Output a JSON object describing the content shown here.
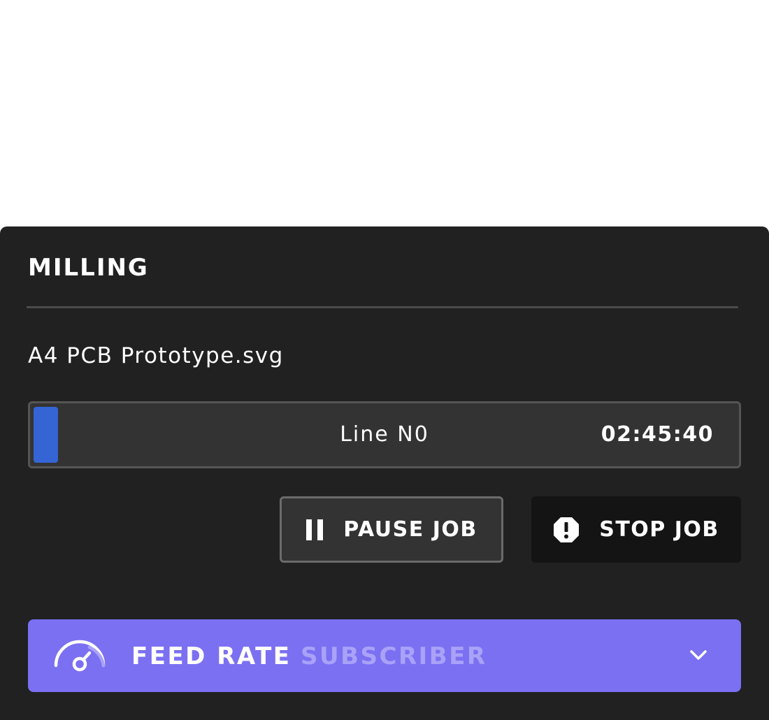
{
  "panel": {
    "title": "MILLING",
    "file_name": "A4 PCB Prototype.svg"
  },
  "progress": {
    "fraction": 0.035,
    "line_text": "Line N0",
    "time_remaining": "02:45:40",
    "fill_color": "#3565d4"
  },
  "actions": {
    "pause_label": "PAUSE JOB",
    "pause_icon": "pause-icon",
    "stop_label": "STOP JOB",
    "stop_icon": "alert-octagon-icon"
  },
  "feed_rate": {
    "label": "FEED RATE",
    "badge": "SUBSCRIBER",
    "icon": "gauge-icon",
    "expand_icon": "chevron-down-icon",
    "color": "#7b70f2"
  }
}
